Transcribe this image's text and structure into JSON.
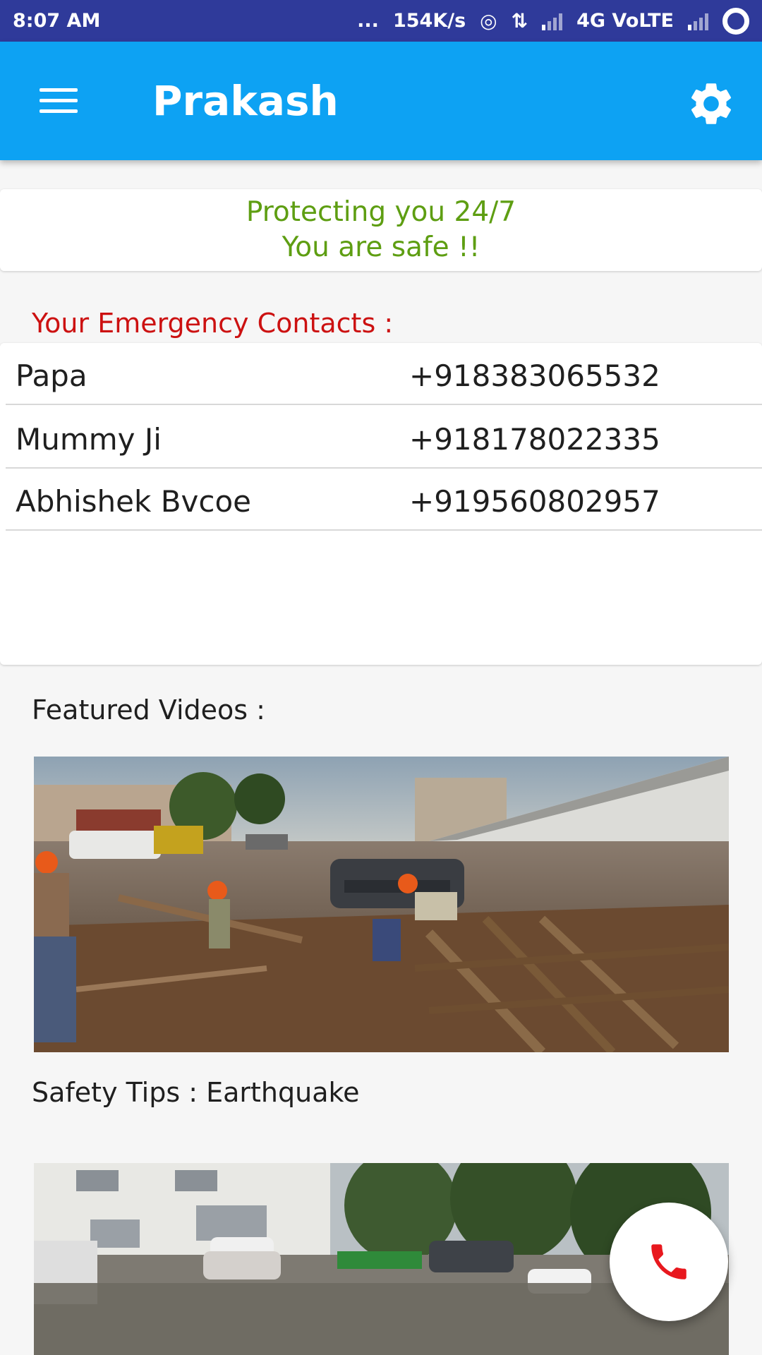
{
  "status_bar": {
    "time": "8:07 AM",
    "dots": "...",
    "speed": "154K/s",
    "network": "4G VoLTE"
  },
  "app_bar": {
    "title": "Prakash",
    "menu_icon": "hamburger-menu-icon",
    "settings_icon": "gear-icon"
  },
  "safety_status": {
    "line1": "Protecting you 24/7",
    "line2": "You are safe !!",
    "color": "#5e9e12"
  },
  "emergency_contacts": {
    "heading": "Your Emergency Contacts :",
    "heading_color": "#cc1111",
    "contacts": [
      {
        "name": "Papa",
        "number": "+918383065532"
      },
      {
        "name": "Mummy Ji",
        "number": "+918178022335"
      },
      {
        "name": "Abhishek Bvcoe",
        "number": "+919560802957"
      }
    ]
  },
  "featured_videos": {
    "heading": "Featured Videos :",
    "videos": [
      {
        "caption": "Safety Tips : Earthquake",
        "thumbnail": "earthquake-rubble-photo"
      },
      {
        "thumbnail": "flooded-street-photo"
      }
    ]
  },
  "fab": {
    "icon": "phone-call-icon",
    "color": "#e8181e"
  },
  "colors": {
    "app_bar": "#0da2f3",
    "status_bar": "#2f3a9a"
  }
}
